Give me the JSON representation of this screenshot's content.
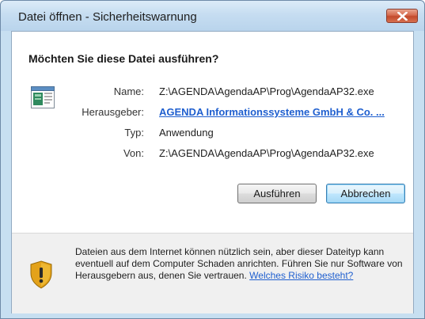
{
  "window": {
    "title": "Datei öffnen - Sicherheitswarnung"
  },
  "dialog": {
    "heading": "Möchten Sie diese Datei ausführen?",
    "fields": [
      {
        "label": "Name:",
        "value": "Z:\\AGENDA\\AgendaAP\\Prog\\AgendaAP32.exe"
      },
      {
        "label": "Herausgeber:",
        "value": "AGENDA Informationssysteme GmbH & Co. ..."
      },
      {
        "label": "Typ:",
        "value": "Anwendung"
      },
      {
        "label": "Von:",
        "value": "Z:\\AGENDA\\AgendaAP\\Prog\\AgendaAP32.exe"
      }
    ],
    "run_button": "Ausführen",
    "cancel_button": "Abbrechen"
  },
  "warning": {
    "text": "Dateien aus dem Internet können nützlich sein, aber dieser Dateityp kann eventuell auf dem Computer Schaden anrichten. Führen Sie nur Software von Herausgebern aus, denen Sie vertrauen. ",
    "link": "Welches Risiko besteht?"
  },
  "icons": {
    "close": "close-icon",
    "app": "application-icon",
    "shield": "security-shield-icon"
  },
  "colors": {
    "link": "#1f5fcf",
    "close_button": "#c24a2c",
    "shield_gold": "#e3a21a"
  }
}
